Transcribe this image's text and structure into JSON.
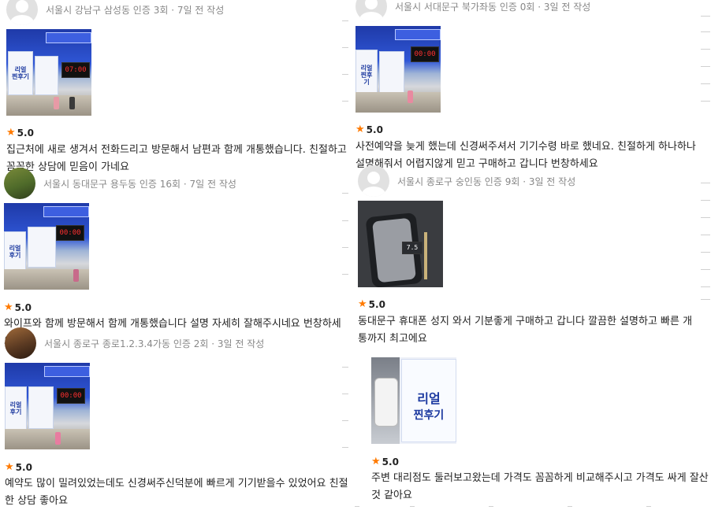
{
  "reviews": [
    {
      "meta": "서울시 강남구 삼성동 인증 3회 · 7일 전 작성",
      "rating": "5.0",
      "text": "집근처에 새로 생겨서 전화드리고 방문해서 남편과 함께 개통했습니다. 친절하고 꼼꼼한 상담에 믿음이 가네요",
      "clock": "07:00"
    },
    {
      "meta": "서울시 동대문구 용두동 인증 16회 · 7일 전 작성",
      "rating": "5.0",
      "text": "와이프와 함께 방문해서 함께 개통했습니다 설명 자세히 잘해주시네요 번창하세요",
      "clock": "00:00"
    },
    {
      "meta": "서울시 종로구 종로1.2.3.4가동 인증 2회 · 3일 전 작성",
      "rating": "5.0",
      "text": "예약도 많이 밀려있었는데도 신경써주신덕분에 빠르게 기기받을수 있었어요 친절한 상담 좋아요",
      "clock": "00:00"
    },
    {
      "meta": "서울시 서대문구 북가좌동 인증 0회 · 3일 전 작성",
      "rating": "5.0",
      "text": "사전예약을 늦게 했는데 신경써주셔서 기기수령 바로 했네요. 친절하게 하나하나 설명해줘서 어렵지않게 믿고 구매하고 갑니다 번창하세요",
      "clock": "00:00"
    },
    {
      "meta": "서울시 종로구 숭인동 인증 9회 · 3일 전 작성",
      "rating": "5.0",
      "text": "동대문구 휴대폰 성지 와서 기분좋게 구매하고 갑니다 깔끔한 설명하고 빠른 개통까지 최고에요",
      "clock": "7.5"
    },
    {
      "meta": "",
      "rating": "5.0",
      "text": "주변 대리점도 둘러보고왔는데 가격도 꼼꼼하게 비교해주시고 가격도 싸게 잘산것 같아요",
      "clock": ""
    }
  ],
  "poster_text": [
    "리얼",
    "찐후기"
  ],
  "colors": {
    "star": "#ff7a00",
    "meta": "#888888",
    "text": "#222222"
  }
}
